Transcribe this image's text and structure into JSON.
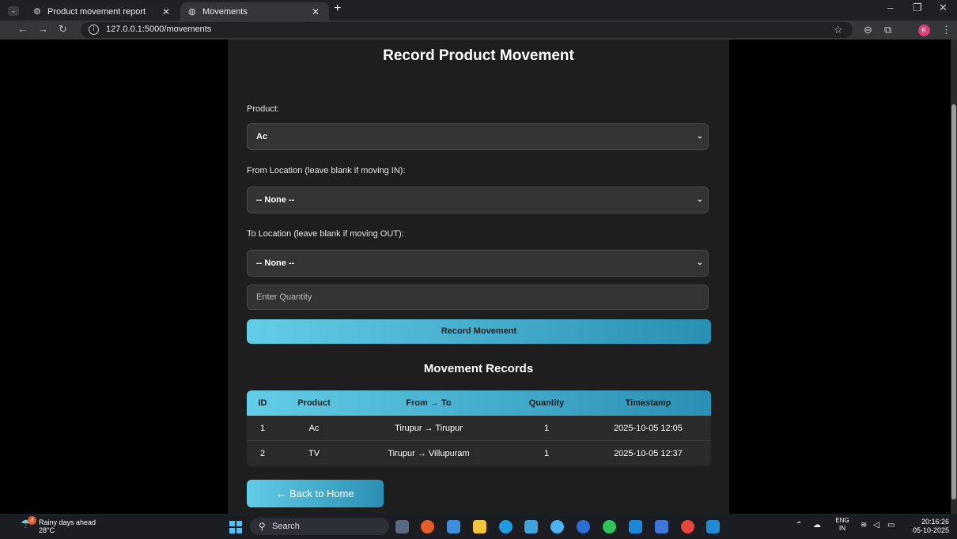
{
  "browser": {
    "tabs": [
      {
        "title": "Product movement report",
        "icon": "gear-icon"
      },
      {
        "title": "Movements",
        "icon": "globe-icon"
      }
    ],
    "url": "127.0.0.1:5000/movements",
    "profile_initial": "K"
  },
  "page": {
    "title": "Record Product Movement",
    "product_label": "Product:",
    "product_value": "Ac",
    "from_label": "From Location (leave blank if moving IN):",
    "from_value": "-- None --",
    "to_label": "To Location (leave blank if moving OUT):",
    "to_value": "-- None --",
    "quantity_placeholder": "Enter Quantity",
    "record_button": "Record Movement",
    "records_title": "Movement Records",
    "table": {
      "headers": [
        "ID",
        "Product",
        "From → To",
        "Quantity",
        "Timestamp"
      ],
      "rows": [
        [
          "1",
          "Ac",
          "Tirupur → Tirupur",
          "1",
          "2025-10-05 12:05"
        ],
        [
          "2",
          "TV",
          "Tirupur → Villupuram",
          "1",
          "2025-10-05 12:37"
        ]
      ]
    },
    "back_button": "← Back to Home"
  },
  "taskbar": {
    "weather_line1": "Rainy days ahead",
    "weather_line2": "28°C",
    "weather_badge": "4",
    "search_label": "Search",
    "lang_line1": "ENG",
    "lang_line2": "IN",
    "time": "20:16:26",
    "date": "05-10-2025"
  },
  "colors": {
    "accent_start": "#62cde6",
    "accent_end": "#2a8fb4",
    "card_bg": "#1e1e1e"
  }
}
